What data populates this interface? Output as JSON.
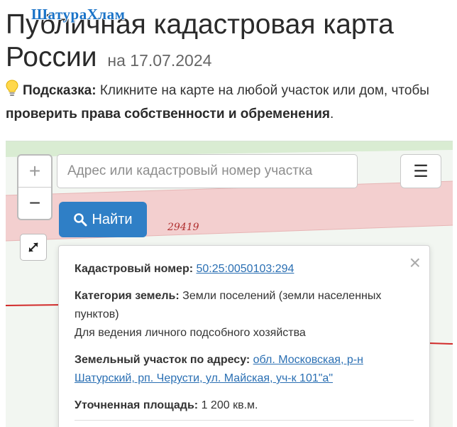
{
  "watermark": "ШатураХлам",
  "page": {
    "title": "Публичная кадастровая карта России",
    "date": "на 17.07.2024"
  },
  "hint": {
    "label": "Подсказка:",
    "text_1": " Кликните на карте на любой участок или дом, чтобы ",
    "text_bold": "проверить права собственности и обременения",
    "text_2": "."
  },
  "map": {
    "zoom_in": "+",
    "zoom_out": "−",
    "search": {
      "placeholder": "Адрес или кадастровый номер участка",
      "value": ""
    },
    "menu_label": "☰",
    "find_button": "Найти",
    "parcel_label": "29419"
  },
  "popup": {
    "close": "×",
    "cadastral_label": "Кадастровый номер:",
    "cadastral_value": "50:25:0050103:294",
    "category_label": "Категория земель:",
    "category_value": "Земли поселений (земли населенных пунктов)",
    "usage_value": "Для ведения личного подсобного хозяйства",
    "address_label": "Земельный участок по адресу:",
    "address_value": "обл. Московская, р-н Шатурский, рп. Черусти, ул. Майская, уч-к 101\"а\"",
    "area_label": "Уточненная площадь:",
    "area_value": "1 200 кв.м."
  },
  "colors": {
    "accent": "#2f7fc6",
    "link": "#2a6fb3",
    "parcel_fill": "#f3cfcf",
    "parcel_line": "#d22b2b",
    "map_green": "#d9ecd2"
  }
}
